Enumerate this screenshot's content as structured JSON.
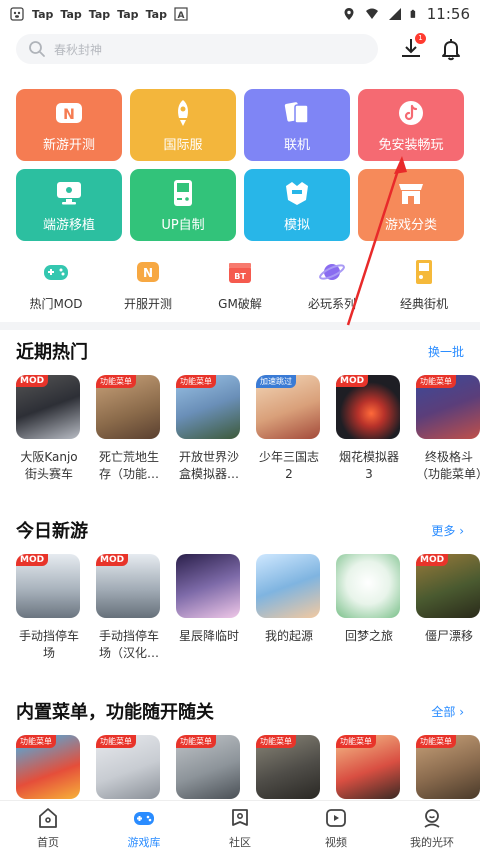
{
  "statusbar": {
    "taps": [
      "Tap",
      "Tap",
      "Tap",
      "Tap",
      "Tap"
    ],
    "time": "11:56"
  },
  "search": {
    "placeholder": "春秋封神",
    "download_badge": "1"
  },
  "tiles": [
    {
      "label": "新游开测",
      "color": "#f57c52",
      "icon": "n-logo-icon"
    },
    {
      "label": "国际服",
      "color": "#f3b63c",
      "icon": "rocket-icon"
    },
    {
      "label": "联机",
      "color": "#7f85f5",
      "icon": "cards-icon"
    },
    {
      "label": "免安装畅玩",
      "color": "#f56a72",
      "icon": "tiktok-icon"
    },
    {
      "label": "端游移植",
      "color": "#2cbfa0",
      "icon": "monitor-icon"
    },
    {
      "label": "UP自制",
      "color": "#32c37a",
      "icon": "gameboy-icon"
    },
    {
      "label": "模拟",
      "color": "#28b6e8",
      "icon": "helmet-icon"
    },
    {
      "label": "游戏分类",
      "color": "#f68a5a",
      "icon": "shop-icon"
    }
  ],
  "categories": [
    {
      "label": "热门MOD",
      "color": "#34c7b0"
    },
    {
      "label": "开服开测",
      "color": "#f7a842"
    },
    {
      "label": "GM破解",
      "color": "#f55a4e"
    },
    {
      "label": "必玩系列",
      "color": "#8a6cf0"
    },
    {
      "label": "经典街机",
      "color": "#f5b93a"
    }
  ],
  "sections": [
    {
      "title": "近期热门",
      "more": "换一批",
      "games": [
        {
          "name": "大阪Kanjo街头赛车",
          "badge": "MOD",
          "bg": "#2d2f36"
        },
        {
          "name": "死亡荒地生存（功能…",
          "badge": "功能菜单",
          "bg": "#8a6a4a"
        },
        {
          "name": "开放世界沙盒模拟器…",
          "badge": "功能菜单",
          "bg": "#6a8fb8"
        },
        {
          "name": "少年三国志2",
          "badge": "加速跳过",
          "bg": "#d9a07a"
        },
        {
          "name": "烟花模拟器3",
          "badge": "MOD",
          "bg": "#1e1e24"
        },
        {
          "name": "终极格斗（功能菜单）",
          "badge": "功能菜单",
          "bg": "#5b3e7a"
        }
      ]
    },
    {
      "title": "今日新游",
      "more": "更多 ›",
      "games": [
        {
          "name": "手动挡停车场",
          "badge": "MOD",
          "bg": "#a9b3bd"
        },
        {
          "name": "手动挡停车场（汉化…",
          "badge": "MOD",
          "bg": "#a2acb6"
        },
        {
          "name": "星辰降临时",
          "badge": "",
          "bg": "#7d6aa8"
        },
        {
          "name": "我的起源",
          "badge": "",
          "bg": "#7fb4e0"
        },
        {
          "name": "回梦之旅",
          "badge": "",
          "bg": "#e8f4ea"
        },
        {
          "name": "僵尸漂移",
          "badge": "MOD",
          "bg": "#4a5a30"
        }
      ]
    },
    {
      "title": "内置菜单，功能随开随关",
      "more": "全部 ›",
      "games": [
        {
          "name": "",
          "badge": "功能菜单",
          "bg": "#e54e3a"
        },
        {
          "name": "",
          "badge": "功能菜单",
          "bg": "#c8ccd2"
        },
        {
          "name": "",
          "badge": "功能菜单",
          "bg": "#8d949a"
        },
        {
          "name": "",
          "badge": "功能菜单",
          "bg": "#4f4d48"
        },
        {
          "name": "",
          "badge": "功能菜单",
          "bg": "#d94f42"
        },
        {
          "name": "",
          "badge": "功能菜单",
          "bg": "#8a6b4e"
        }
      ]
    }
  ],
  "nav": [
    {
      "label": "首页",
      "icon": "home-icon",
      "active": false
    },
    {
      "label": "游戏库",
      "icon": "gamepad-icon",
      "active": true
    },
    {
      "label": "社区",
      "icon": "community-icon",
      "active": false
    },
    {
      "label": "视频",
      "icon": "video-icon",
      "active": false
    },
    {
      "label": "我的光环",
      "icon": "profile-icon",
      "active": false
    }
  ],
  "colors": {
    "accent": "#2a8cff",
    "badge_red": "#e8342a"
  }
}
